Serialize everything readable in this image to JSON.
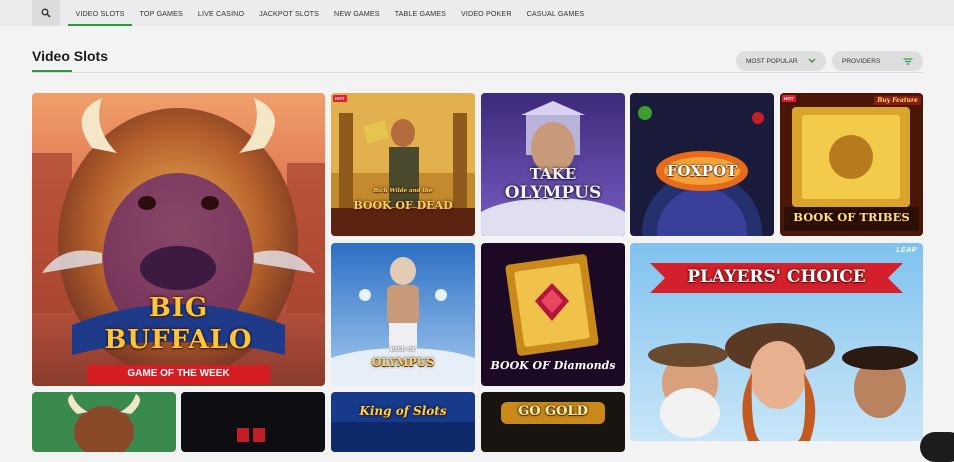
{
  "nav": {
    "tabs": [
      {
        "label": "VIDEO SLOTS",
        "active": true
      },
      {
        "label": "TOP GAMES"
      },
      {
        "label": "LIVE CASINO"
      },
      {
        "label": "JACKPOT SLOTS"
      },
      {
        "label": "NEW GAMES"
      },
      {
        "label": "TABLE GAMES"
      },
      {
        "label": "VIDEO POKER"
      },
      {
        "label": "CASUAL GAMES"
      }
    ],
    "search_icon": "search-icon"
  },
  "page": {
    "title": "Video Slots",
    "sort_label": "MOST POPULAR",
    "providers_label": "PROVIDERS"
  },
  "colors": {
    "accent": "#2a9d3a",
    "hot_badge": "#e01e2d"
  },
  "games": {
    "big_buffalo": {
      "title_line1": "BIG",
      "title_line2": "BUFFALO",
      "banner": "GAME OF THE WEEK"
    },
    "book_of_dead": {
      "badge": "HOT",
      "subtitle": "Rich Wilde and the",
      "title": "BOOK OF DEAD"
    },
    "take_olympus": {
      "title_line1": "TAKE",
      "title_line2": "OLYMPUS"
    },
    "foxpot": {
      "title": "FOXPOT"
    },
    "book_of_tribes": {
      "badge": "HOT",
      "corner": "Buy Feature",
      "title": "BOOK OF TRIBES"
    },
    "rise_of_olympus": {
      "subtitle": "RISE OF",
      "title": "OLYMPUS"
    },
    "book_of_diamonds": {
      "title": "BOOK OF Diamonds"
    },
    "players_choice": {
      "corner": "LEAP",
      "title": "PLAYERS' CHOICE"
    },
    "king_of_slots": {
      "title": "King of Slots"
    },
    "go_gold": {
      "title": "GO GOLD"
    }
  }
}
